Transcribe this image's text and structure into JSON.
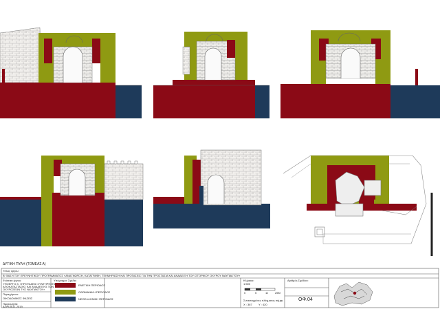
{
  "colors": {
    "venetian": "#8b0a16",
    "ottoman": "#8f9a12",
    "neohellenic": "#1e3a5a",
    "masonry_fill": "#f1efec",
    "line": "#6e6e6e"
  },
  "caption": {
    "west_wall": "ΔΥΤΙΚΗ ΠΥΛΗ (ΤΟΜΕΑΣ Α)"
  },
  "title_block": {
    "project_label": "Τίτλος έργου:",
    "project_title": "Β' ΦΑΣΗ ΤΟΥ ΕΡΕΥΝΗΤΙΚΟΥ ΠΡΟΓΡΑΜΜΑΤΟΣ «ΑΝΑΓΝΩΡΙΣΗ, ΚΑΤΑΓΡΑΦΗ, ΤΕΚΜΗΡΙΩΣΗ ΚΑΙ ΠΡΟΤΑΣΕΙΣ ΓΙΑ ΤΗΝ ΠΡΟΣΤΑΣΙΑ ΚΑΙ ΑΝΑΔΕΙΞΗ ΤΟΥ ΙΣΤΟΡΙΚΟΥ ΟΧΥΡΟΥ ΝΑΥΠΑΚΤΟΥ»",
    "subproject_label": "Ενότητα έργου:",
    "subproject": [
      "ΥΠΟΕΡΓΟ 3: «ΠΡΟΤΑΣΕΙΣ ΣΥΝΤΗΡΗΣΗΣ",
      "ΑΠΟΚΑΤΑΣΤΑΣΗΣ ΚΑΙ ΑΝΑΔΕΙΞΗΣ ΤΩΝ",
      "ΟΧΥΡΩΣΕΩΝ ΤΗΣ ΝΑΥΠΑΚΤΟΥ»"
    ],
    "phase_label": "Περιεχόμενο:",
    "phase": "ΟΙΚΟΔΟΜΙΚΕΣ  ΦΑΣΕΙΣ",
    "date_label": "Ημερομηνία:",
    "date": "ΑΠΡΙΛΙΟΣ   2019",
    "legend_title": "Υπόμνημα: Σχέδια",
    "legend": [
      {
        "label": "ΕΝΕΤΙΚΗ ΠΕΡΙΟΔΟΣ",
        "color": "#8b0a16"
      },
      {
        "label": "ΟΘΩΜΑΝΙΚΗ ΠΕΡΙΟΔΟΣ",
        "color": "#8f9a12"
      },
      {
        "label": "ΝΕΟΕΛΛΗΝΙΚΗ ΠΕΡΙΟΔΟΣ",
        "color": "#1e3a5a"
      }
    ],
    "scale_label": "Κλίμακα:",
    "scale": "1:500",
    "scale_ticks": [
      "0",
      "5",
      "10",
      "25M"
    ],
    "scale_note": "Συντεταγμένες πλέγματος σύμφωνα με σύστημα ΕΓΣΑ",
    "coords": [
      "X : 367",
      "Y : 420"
    ],
    "drawing_no_label": "Αριθμός Σχεδίου:",
    "drawing_no": "ΟΦ.04"
  }
}
